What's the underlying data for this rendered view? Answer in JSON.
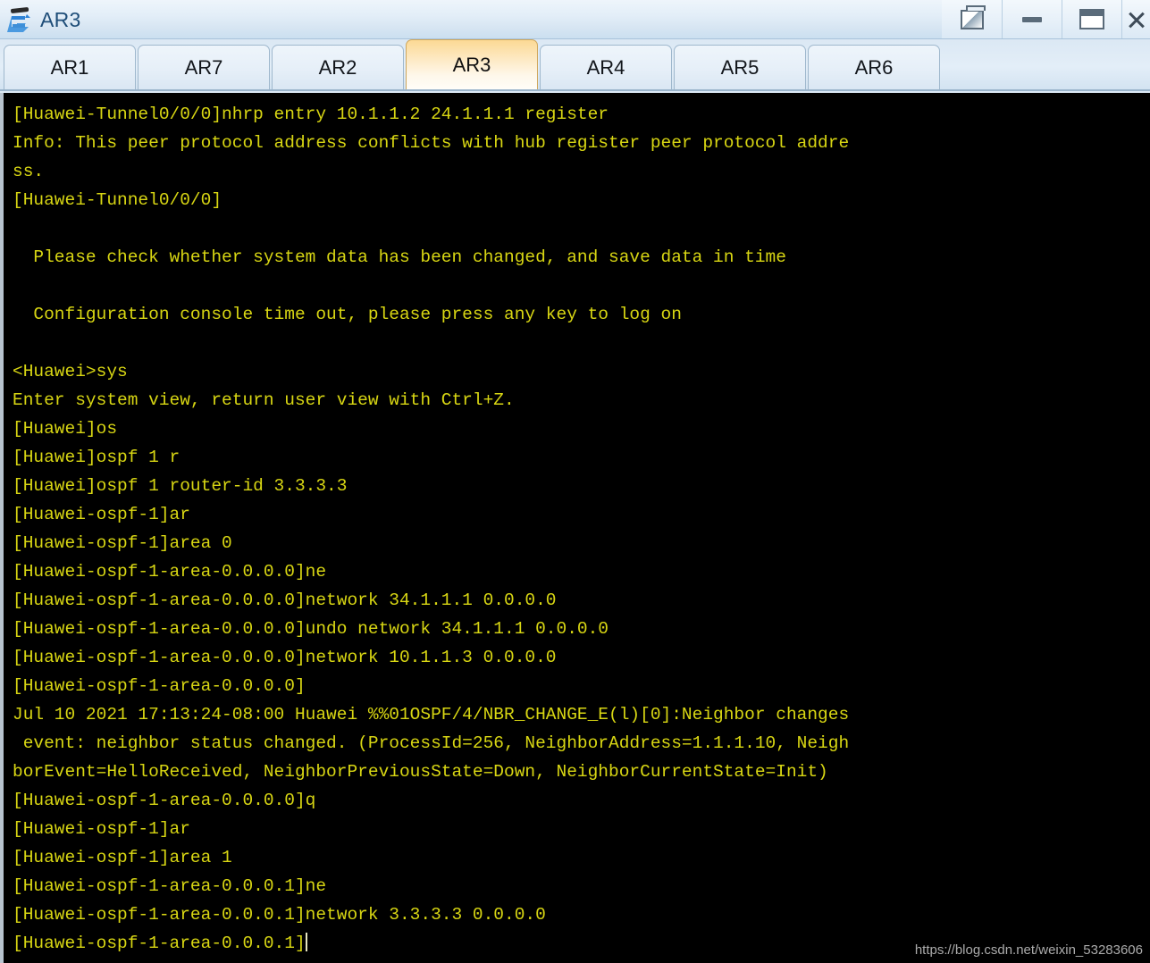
{
  "window": {
    "title": "AR3",
    "icon": "router-icon",
    "controls": [
      {
        "name": "restore-button",
        "icon": "restore-icon",
        "label": "Restore"
      },
      {
        "name": "minimize-button",
        "icon": "minimize-icon",
        "label": "Minimize"
      },
      {
        "name": "maximize-button",
        "icon": "maximize-icon",
        "label": "Maximize"
      },
      {
        "name": "close-button",
        "icon": "close-icon",
        "label": "Close"
      }
    ]
  },
  "tabs": {
    "active": "AR3",
    "items": [
      {
        "label": "AR1",
        "active": false
      },
      {
        "label": "AR7",
        "active": false
      },
      {
        "label": "AR2",
        "active": false
      },
      {
        "label": "AR3",
        "active": true
      },
      {
        "label": "AR4",
        "active": false
      },
      {
        "label": "AR5",
        "active": false
      },
      {
        "label": "AR6",
        "active": false
      }
    ]
  },
  "terminal": {
    "foreground_color": "#d8d613",
    "background_color": "#000000",
    "lines": [
      "[Huawei-Tunnel0/0/0]nhrp entry 10.1.1.2 24.1.1.1 register",
      "Info: This peer protocol address conflicts with hub register peer protocol addre",
      "ss.",
      "[Huawei-Tunnel0/0/0]",
      "",
      "  Please check whether system data has been changed, and save data in time",
      "",
      "  Configuration console time out, please press any key to log on",
      "",
      "<Huawei>sys",
      "Enter system view, return user view with Ctrl+Z.",
      "[Huawei]os",
      "[Huawei]ospf 1 r",
      "[Huawei]ospf 1 router-id 3.3.3.3",
      "[Huawei-ospf-1]ar",
      "[Huawei-ospf-1]area 0",
      "[Huawei-ospf-1-area-0.0.0.0]ne",
      "[Huawei-ospf-1-area-0.0.0.0]network 34.1.1.1 0.0.0.0",
      "[Huawei-ospf-1-area-0.0.0.0]undo network 34.1.1.1 0.0.0.0",
      "[Huawei-ospf-1-area-0.0.0.0]network 10.1.1.3 0.0.0.0",
      "[Huawei-ospf-1-area-0.0.0.0]",
      "Jul 10 2021 17:13:24-08:00 Huawei %%01OSPF/4/NBR_CHANGE_E(l)[0]:Neighbor changes",
      " event: neighbor status changed. (ProcessId=256, NeighborAddress=1.1.1.10, Neigh",
      "borEvent=HelloReceived, NeighborPreviousState=Down, NeighborCurrentState=Init)",
      "[Huawei-ospf-1-area-0.0.0.0]q",
      "[Huawei-ospf-1]ar",
      "[Huawei-ospf-1]area 1",
      "[Huawei-ospf-1-area-0.0.0.1]ne",
      "[Huawei-ospf-1-area-0.0.0.1]network 3.3.3.3 0.0.0.0",
      "[Huawei-ospf-1-area-0.0.0.1]"
    ],
    "cursor_line_index": 29
  },
  "watermark": {
    "text": "https://blog.csdn.net/weixin_53283606"
  }
}
